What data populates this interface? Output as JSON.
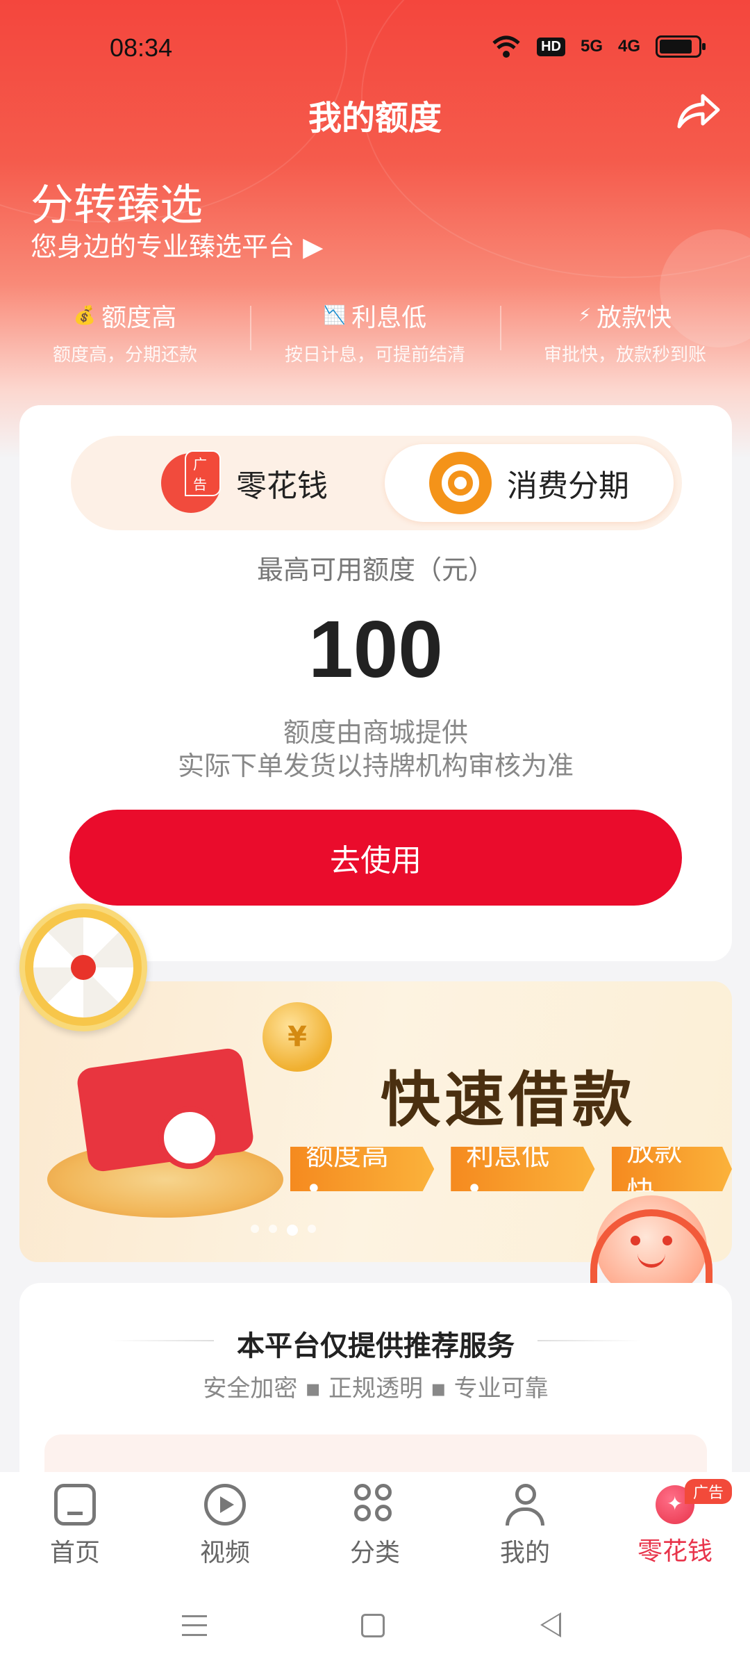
{
  "status_bar": {
    "time": "08:34",
    "network_1": "5G",
    "network_2": "4G",
    "hd_label": "HD"
  },
  "header": {
    "title": "我的额度",
    "share_icon": "share-icon"
  },
  "brand": {
    "name": "分转臻选",
    "subtitle": "您身边的专业臻选平台 ▶"
  },
  "features": [
    {
      "title": "额度高",
      "sub": "额度高，分期还款",
      "icon": "money-bag-icon"
    },
    {
      "title": "利息低",
      "sub": "按日计息，可提前结清",
      "icon": "chart-down-icon"
    },
    {
      "title": "放款快",
      "sub": "审批快，放款秒到账",
      "icon": "lightning-icon"
    }
  ],
  "credit_card": {
    "tabs": [
      {
        "label": "零花钱",
        "badge": "广告",
        "icon": "lhq-logo"
      },
      {
        "label": "消费分期",
        "icon": "installment-logo",
        "selected": true
      }
    ],
    "limit_label": "最高可用额度（元）",
    "limit_value": "100",
    "note_1": "额度由商城提供",
    "note_2": "实际下单发货以持牌机构审核为准",
    "button_label": "去使用"
  },
  "banner": {
    "title": "快速借款",
    "tags": [
      "额度高 •",
      "利息低 •",
      "放款快"
    ],
    "coin_symbol": "¥",
    "active_dot": 2,
    "dot_count": 4
  },
  "recommend": {
    "title": "本平台仅提供推荐服务",
    "subtitle": "安全加密  ▪  正规透明  ▪  专业可靠"
  },
  "bottom_nav": [
    {
      "label": "首页",
      "icon": "home-icon"
    },
    {
      "label": "视频",
      "icon": "video-play-icon"
    },
    {
      "label": "分类",
      "icon": "category-icon"
    },
    {
      "label": "我的",
      "icon": "profile-icon"
    },
    {
      "label": "零花钱",
      "icon": "lhq-icon",
      "badge": "广告",
      "active": true
    }
  ],
  "colors": {
    "primary_red": "#ea0c2c",
    "hero_red": "#f4463d",
    "accent_orange": "#f49319",
    "active_nav": "#e8334a"
  }
}
